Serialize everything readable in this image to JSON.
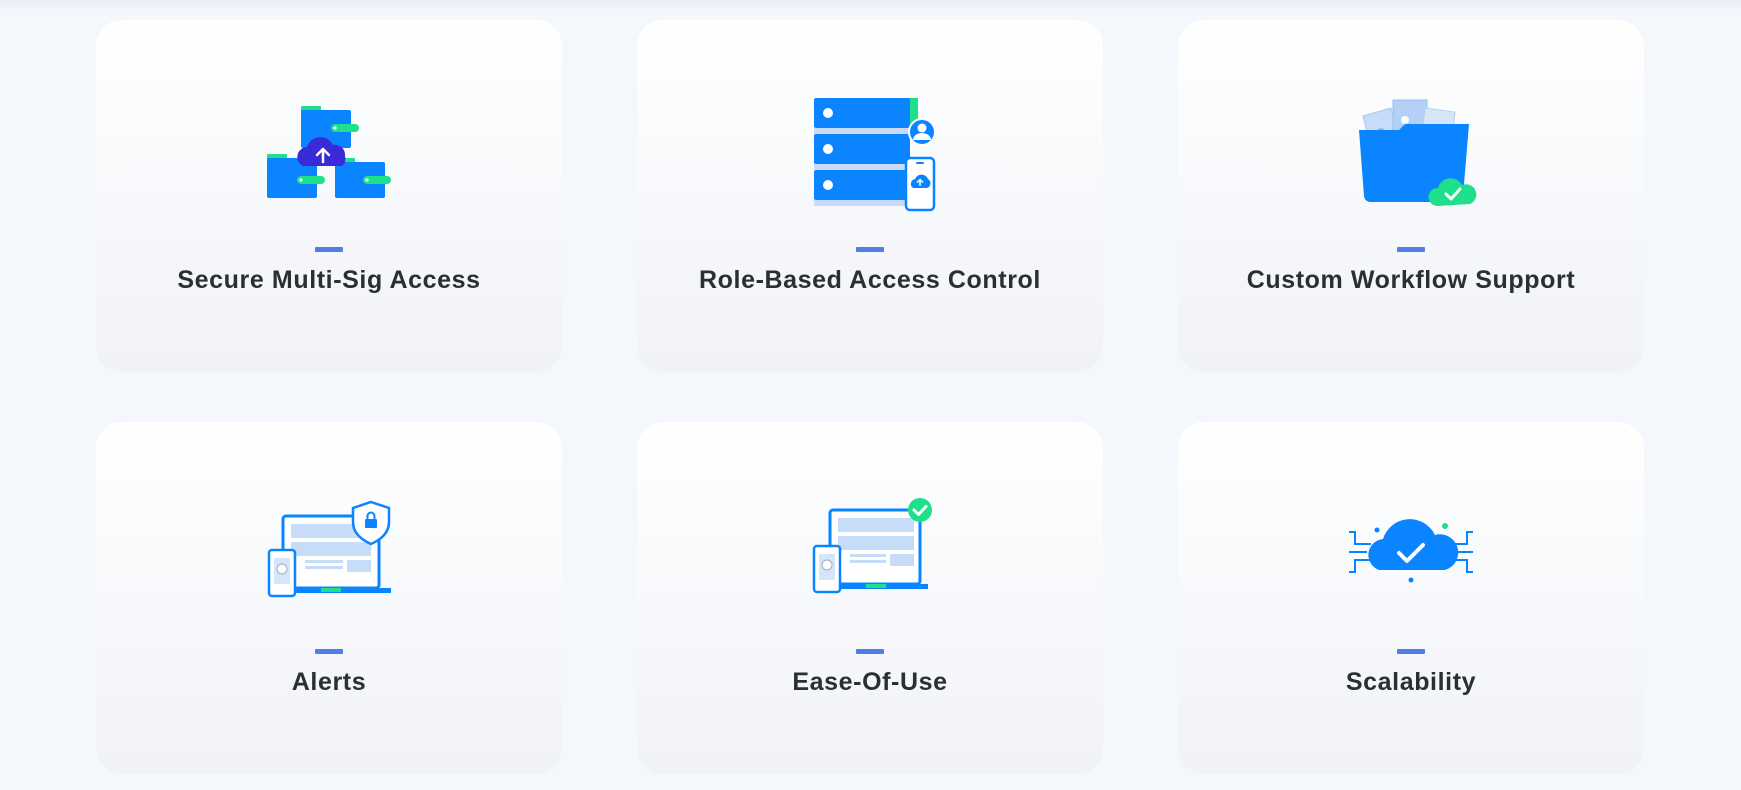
{
  "features": [
    {
      "title": "Secure Multi-Sig Access",
      "icon": "multi-folder-upload-icon"
    },
    {
      "title": "Role-Based Access Control",
      "icon": "server-user-phone-icon"
    },
    {
      "title": "Custom Workflow Support",
      "icon": "folder-cloud-check-icon"
    },
    {
      "title": "Alerts",
      "icon": "laptop-phone-shield-icon"
    },
    {
      "title": "Ease-Of-Use",
      "icon": "laptop-phone-check-icon"
    },
    {
      "title": "Scalability",
      "icon": "cloud-circuit-check-icon"
    }
  ],
  "colors": {
    "primary_blue": "#0a84ff",
    "accent_green": "#1fe08a",
    "dash_blue": "#4f7fe6",
    "title_text": "#2b2e33"
  }
}
